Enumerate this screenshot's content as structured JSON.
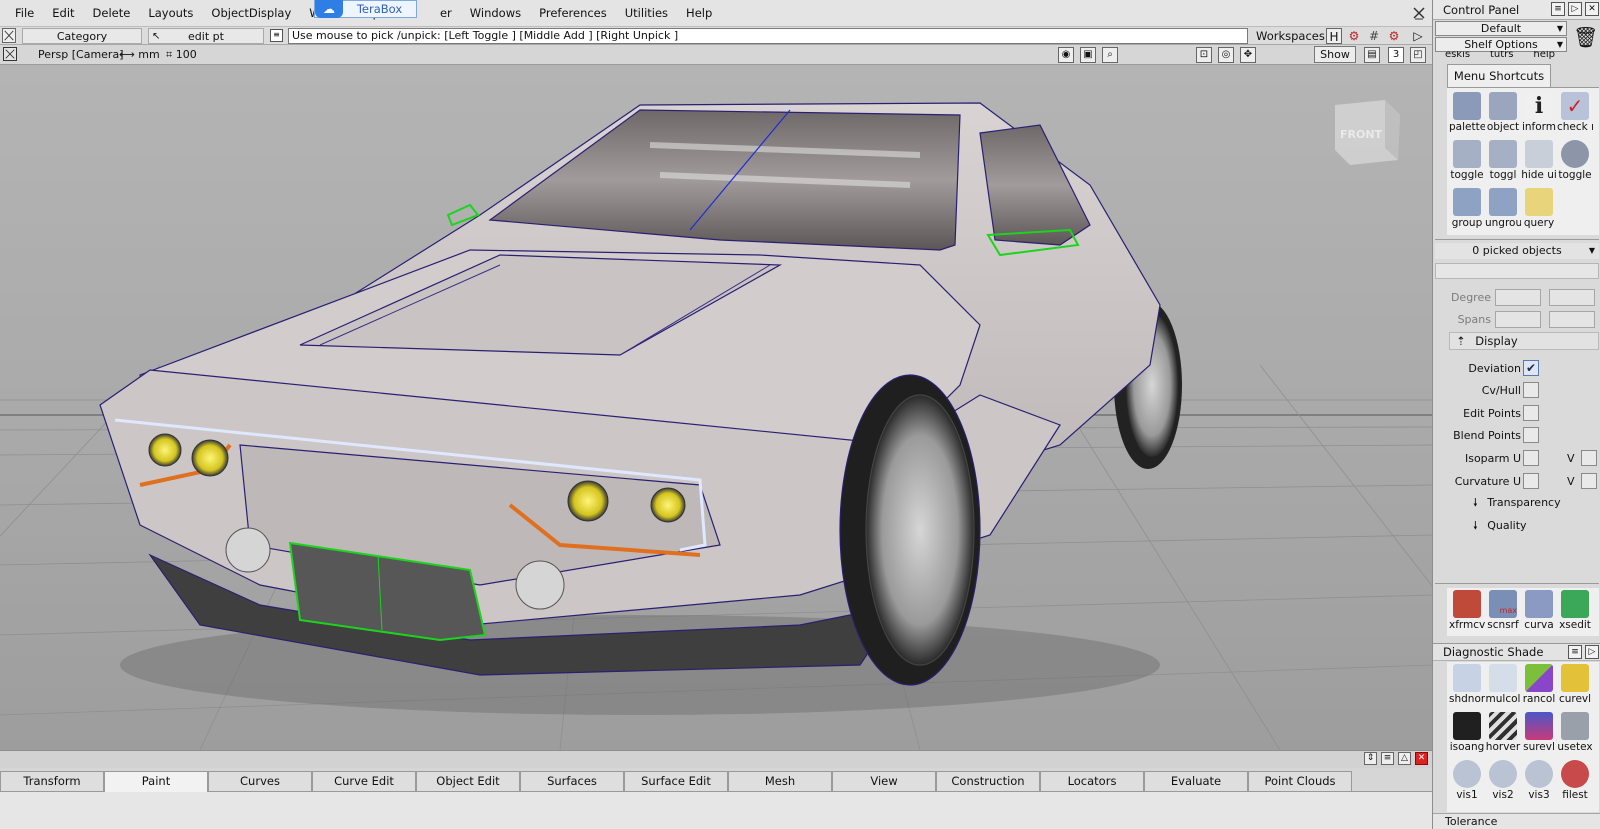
{
  "menubar": {
    "items": [
      "File",
      "Edit",
      "Delete",
      "Layouts",
      "ObjectDisplay",
      "WindowDisp",
      "er",
      "Windows",
      "Preferences",
      "Utilities",
      "Help"
    ],
    "overlay_label": "TeraBox"
  },
  "toolbar": {
    "category_label": "Category",
    "tool_label": "edit pt",
    "prompt": "Use mouse to pick /unpick: [Left Toggle ] [Middle Add ] [Right Unpick ]",
    "workspaces_label": "Workspaces"
  },
  "viewport": {
    "camera_label": "Persp [Camera]",
    "unit_label": "mm",
    "grid_label": "100",
    "show_label": "Show",
    "layer_count": "3",
    "view_cube_label": "FRONT"
  },
  "shelf": {
    "tabs": [
      "Transform",
      "Paint",
      "Curves",
      "Curve Edit",
      "Object Edit",
      "Surfaces",
      "Surface Edit",
      "Mesh",
      "View",
      "Construction",
      "Locators",
      "Evaluate",
      "Point Clouds"
    ],
    "active_tab": "Paint"
  },
  "panel": {
    "title": "Control Panel",
    "workspace_dropdown": "Default",
    "shelf_options": "Shelf Options",
    "mini_tabs": [
      "eskis",
      "tutrs",
      "help"
    ],
    "menu_shortcuts_tab": "Menu Shortcuts",
    "shortcuts": [
      {
        "label": "palette",
        "icon": "palette-icon",
        "color": "#8a9ab8"
      },
      {
        "label": "object",
        "icon": "object-icon",
        "color": "#9aa6bd"
      },
      {
        "label": "inform",
        "icon": "info-icon",
        "color": "#333333"
      },
      {
        "label": "check r",
        "icon": "check-icon",
        "color": "#b8c2d8"
      },
      {
        "label": "toggle",
        "icon": "toggle-icon",
        "color": "#a6b0c4"
      },
      {
        "label": "toggl",
        "icon": "toggle-icon",
        "color": "#a6b0c4"
      },
      {
        "label": "hide ui",
        "icon": "hide-icon",
        "color": "#c9cfd9"
      },
      {
        "label": "toggle",
        "icon": "sphere-grid-icon",
        "color": "#8d96a8"
      },
      {
        "label": "group",
        "icon": "group-icon",
        "color": "#8ea2c4"
      },
      {
        "label": "ungrou",
        "icon": "ungroup-icon",
        "color": "#8ea2c4"
      },
      {
        "label": "query",
        "icon": "query-icon",
        "color": "#e8d47a"
      }
    ],
    "picked_objects": "0 picked objects",
    "degree_label": "Degree",
    "spans_label": "Spans",
    "display_head": "Display",
    "options": [
      {
        "label": "Deviation",
        "checked": true,
        "v": false
      },
      {
        "label": "Cv/Hull",
        "checked": false,
        "v": false
      },
      {
        "label": "Edit Points",
        "checked": false,
        "v": false
      },
      {
        "label": "Blend Points",
        "checked": false,
        "v": false
      },
      {
        "label": "Isoparm U",
        "checked": false,
        "v": true
      },
      {
        "label": "Curvature U",
        "checked": false,
        "v": true
      }
    ],
    "v_label": "V",
    "sub_sections": [
      "Transparency",
      "Quality"
    ],
    "tool_row": [
      {
        "label": "xfrmcv",
        "color": "#c04a3a"
      },
      {
        "label": "scnsrf",
        "color": "#7a8fb5"
      },
      {
        "label": "curva",
        "color": "#8a9ac2"
      },
      {
        "label": "xsedit",
        "color": "#3aa858"
      }
    ],
    "mini_max_label": "max",
    "diag_head": "Diagnostic Shade",
    "diag_items": [
      {
        "label": "shdnon",
        "color": "#c7d2e4"
      },
      {
        "label": "mulcol",
        "color": "#d5dde8"
      },
      {
        "label": "rancol",
        "color": "#7bbf3a"
      },
      {
        "label": "curevl",
        "color": "#e3c23a"
      },
      {
        "label": "isoang",
        "color": "#202020"
      },
      {
        "label": "horver",
        "color": "#303030"
      },
      {
        "label": "surevl",
        "color": "#4a58c8"
      },
      {
        "label": "usetex",
        "color": "#9aa0aa"
      },
      {
        "label": "vis1",
        "color": "#b9c3d3"
      },
      {
        "label": "vis2",
        "color": "#b9c3d3"
      },
      {
        "label": "vis3",
        "color": "#b9c3d3"
      },
      {
        "label": "filest",
        "color": "#c84a4a"
      }
    ],
    "tolerance_label": "Tolerance"
  }
}
